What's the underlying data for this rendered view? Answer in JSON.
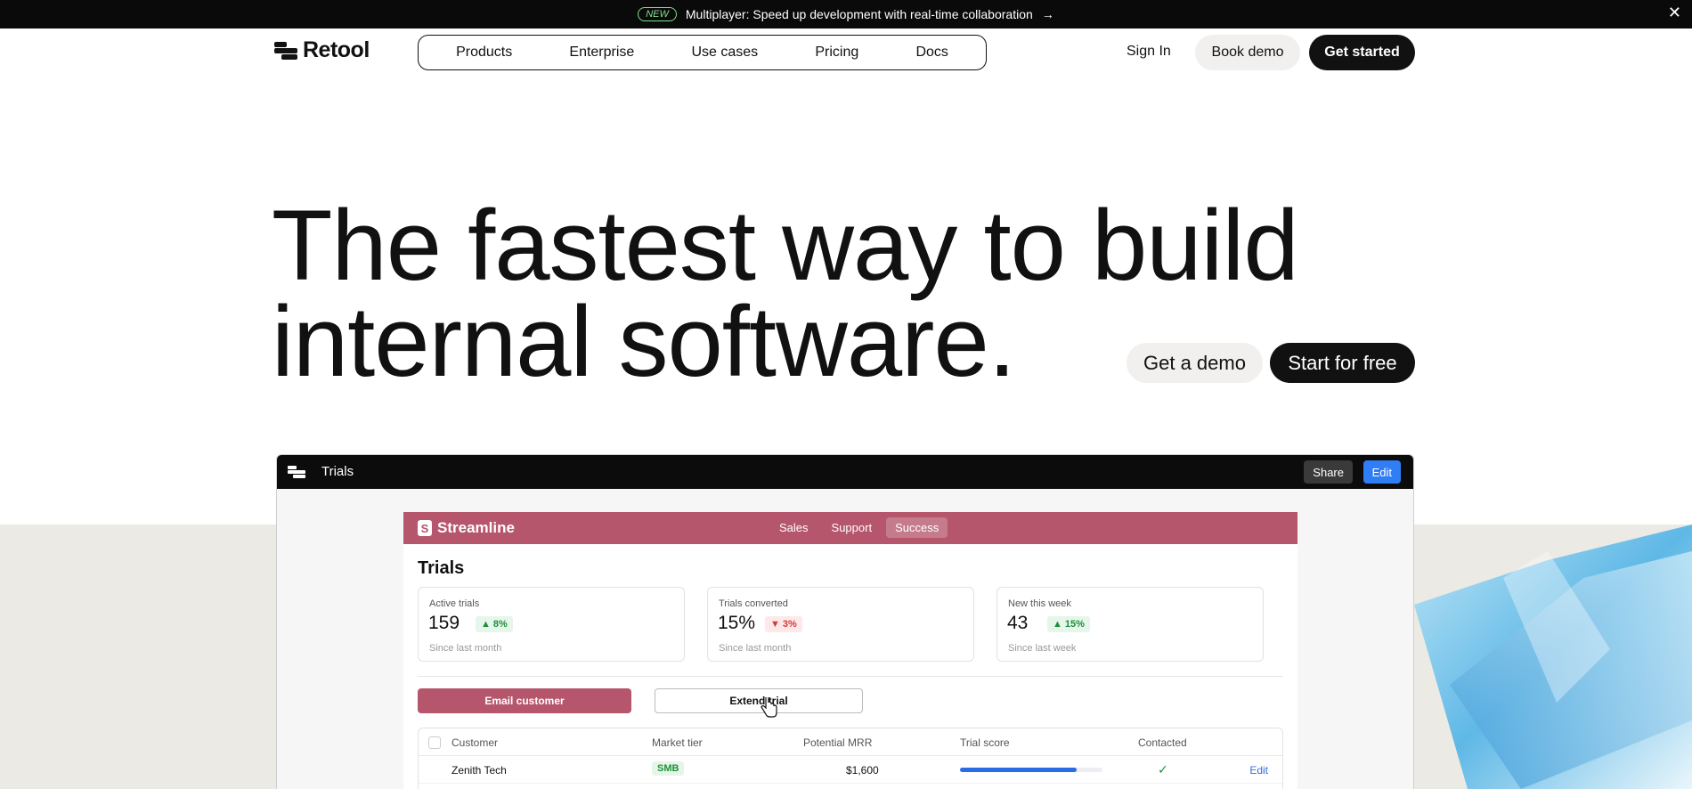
{
  "announcement": {
    "badge": "NEW",
    "text": "Multiplayer: Speed up development with real-time collaboration",
    "arrow": "→",
    "close": "✕"
  },
  "header": {
    "brand": "Retool",
    "nav": [
      "Products",
      "Enterprise",
      "Use cases",
      "Pricing",
      "Docs"
    ],
    "sign_in": "Sign In",
    "book_demo": "Book demo",
    "get_started": "Get started"
  },
  "hero": {
    "title_line1": "The fastest way to build",
    "title_line2": "internal software.",
    "cta_demo": "Get a demo",
    "cta_start": "Start for free"
  },
  "app": {
    "title": "Trials",
    "share": "Share",
    "edit": "Edit",
    "brand": "Streamline",
    "tabs": [
      "Sales",
      "Support",
      "Success"
    ],
    "active_tab": "Success",
    "page_title": "Trials",
    "kpis": [
      {
        "label": "Active trials",
        "value": "159",
        "change": "8%",
        "direction": "up",
        "sub": "Since last month"
      },
      {
        "label": "Trials converted",
        "value": "15%",
        "change": "3%",
        "direction": "down",
        "sub": "Since last month"
      },
      {
        "label": "New this week",
        "value": "43",
        "change": "15%",
        "direction": "up",
        "sub": "Since last week"
      }
    ],
    "email_button": "Email customer",
    "extend_button": "Extend trial",
    "table": {
      "headers": [
        "Customer",
        "Market tier",
        "Potential MRR",
        "Trial score",
        "Contacted"
      ],
      "rows": [
        {
          "customer": "Zenith Tech",
          "tier": "SMB",
          "mrr": "$1,600",
          "score": 0.82,
          "contacted": true,
          "action": "Edit"
        }
      ]
    }
  },
  "colors": {
    "accent": "#b5566c",
    "primary_blue": "#2f7ef5",
    "dark": "#111111",
    "background_band": "#eceae4"
  }
}
